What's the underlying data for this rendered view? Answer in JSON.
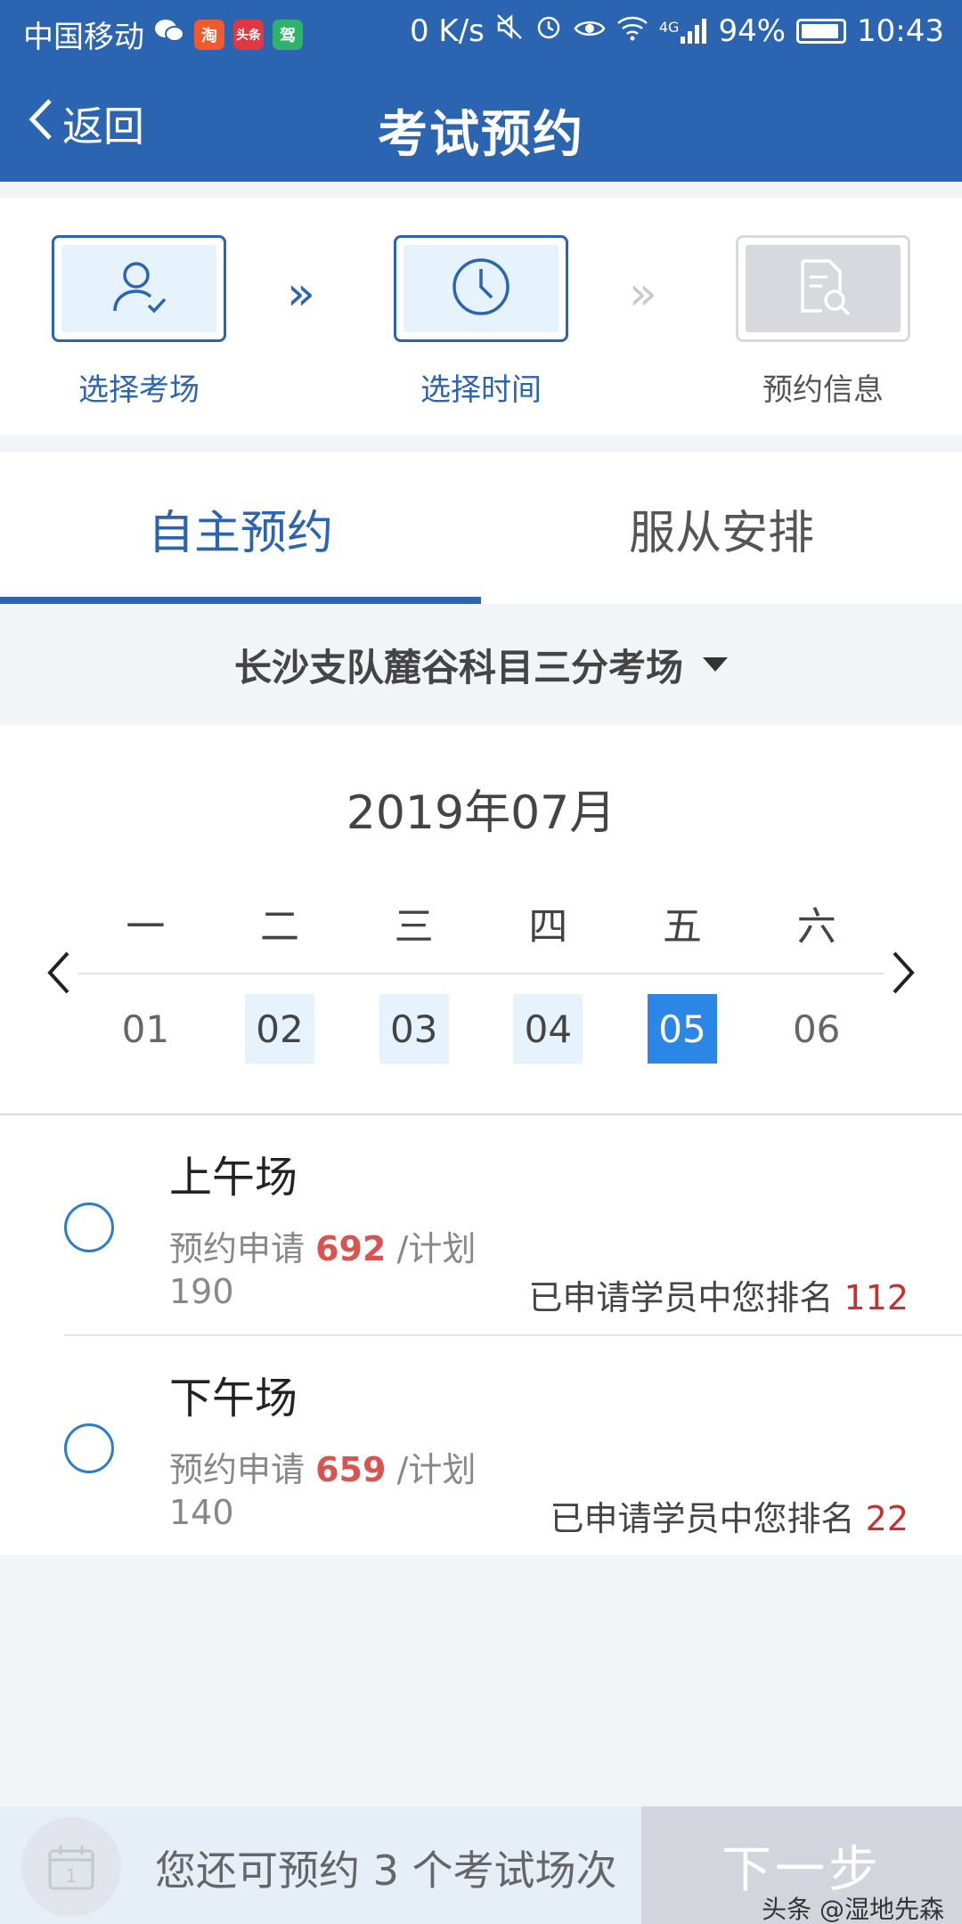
{
  "status_bar": {
    "carrier": "中国移动",
    "apps": [
      {
        "icon": "wechat-icon",
        "text": ""
      },
      {
        "icon": "taobao-icon",
        "text": "淘",
        "color": "#f2592d"
      },
      {
        "icon": "toutiao-icon",
        "text": "头条",
        "color": "#e0383e"
      },
      {
        "icon": "jiakao-icon",
        "text": "驾",
        "color": "#2fb36b"
      }
    ],
    "speed": "0 K/s",
    "network": "4G",
    "battery": "94%",
    "battery_level": 0.94,
    "time": "10:43"
  },
  "nav": {
    "back_label": "返回",
    "title": "考试预约"
  },
  "steps": [
    {
      "label": "选择考场",
      "icon": "user-check-icon",
      "state": "done"
    },
    {
      "label": "选择时间",
      "icon": "clock-icon",
      "state": "active"
    },
    {
      "label": "预约信息",
      "icon": "document-search-icon",
      "state": "pending"
    }
  ],
  "tabs": [
    {
      "label": "自主预约",
      "active": true
    },
    {
      "label": "服从安排",
      "active": false
    }
  ],
  "venue": {
    "name": "长沙支队麓谷科目三分考场"
  },
  "calendar": {
    "month": "2019年07月",
    "weekdays": [
      "一",
      "二",
      "三",
      "四",
      "五",
      "六"
    ],
    "days": [
      {
        "label": "01",
        "state": "normal"
      },
      {
        "label": "02",
        "state": "available"
      },
      {
        "label": "03",
        "state": "available"
      },
      {
        "label": "04",
        "state": "available"
      },
      {
        "label": "05",
        "state": "selected"
      },
      {
        "label": "06",
        "state": "normal"
      }
    ]
  },
  "sessions": [
    {
      "title": "上午场",
      "apply_prefix": "预约申请",
      "apply_count": "692",
      "plan_prefix": "/计划",
      "plan_count": "190",
      "rank_prefix": "已申请学员中您排名",
      "rank": "112"
    },
    {
      "title": "下午场",
      "apply_prefix": "预约申请",
      "apply_count": "659",
      "plan_prefix": "/计划",
      "plan_count": "140",
      "rank_prefix": "已申请学员中您排名",
      "rank": "22"
    }
  ],
  "bottom": {
    "remaining_text": "您还可预约 3 个考试场次",
    "next_label": "下一步",
    "calendar_icon_day": "1"
  },
  "watermark": "头条 @湿地先森",
  "colors": {
    "brand": "#2b64b0",
    "selected_day": "#2b86e6",
    "highlight_number": "#d9534f"
  }
}
